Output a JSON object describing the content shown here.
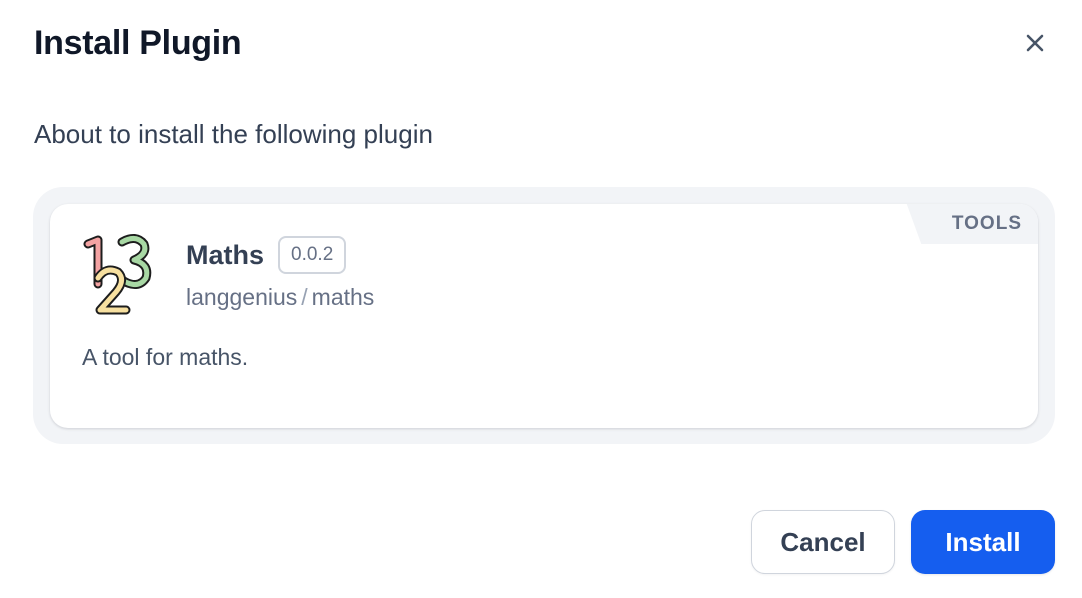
{
  "dialog": {
    "title": "Install Plugin",
    "subtitle": "About to install the following plugin",
    "close_icon": "close-icon"
  },
  "plugin": {
    "name": "Maths",
    "version": "0.0.2",
    "org": "langgenius",
    "separator": "/",
    "slug": "maths",
    "description": "A tool for maths.",
    "category": "TOOLS",
    "icon": "numbers-123-icon"
  },
  "actions": {
    "cancel_label": "Cancel",
    "install_label": "Install"
  },
  "colors": {
    "primary": "#155eef",
    "panel_bg": "#f2f4f7",
    "text_dark": "#101828",
    "text_muted": "#667085"
  }
}
